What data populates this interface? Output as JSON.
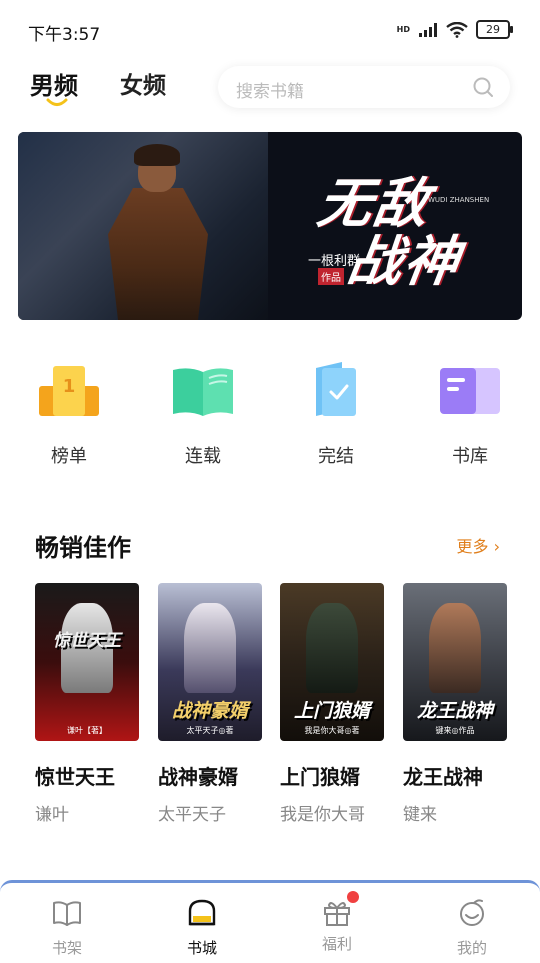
{
  "status": {
    "time": "下午3:57",
    "network": "HD",
    "battery": "29"
  },
  "top_nav": {
    "tabs": [
      "男频",
      "女频"
    ],
    "active": "男频",
    "search_placeholder": "搜索书籍"
  },
  "banner": {
    "title_line1": "无敌",
    "title_line2": "战神",
    "author": "一根利群",
    "badge": "作品",
    "pinyin": "WUDI ZHANSHEN"
  },
  "categories": [
    {
      "label": "榜单",
      "icon": "ranking-icon"
    },
    {
      "label": "连载",
      "icon": "open-book-icon"
    },
    {
      "label": "完结",
      "icon": "finished-book-icon"
    },
    {
      "label": "书库",
      "icon": "library-icon"
    }
  ],
  "section": {
    "title": "畅销佳作",
    "more": "更多 ›"
  },
  "books": [
    {
      "title": "惊世天王",
      "author": "谦叶",
      "cover_title": "惊世天王",
      "cover_author": "谦叶【著】"
    },
    {
      "title": "战神豪婿",
      "author": "太平天子",
      "cover_title": "战神豪婿",
      "cover_author": "太平天子◎著"
    },
    {
      "title": "上门狼婿",
      "author": "我是你大哥",
      "cover_title": "上门狼婿",
      "cover_author": "我是你大哥◎著"
    },
    {
      "title": "龙王战神",
      "author": "键来",
      "cover_title": "龙王战神",
      "cover_author": "键来◎作品"
    }
  ],
  "tabbar": [
    {
      "label": "书架",
      "icon": "bookshelf-icon"
    },
    {
      "label": "书城",
      "icon": "bookstore-icon",
      "active": true
    },
    {
      "label": "福利",
      "icon": "gift-icon",
      "badge": true
    },
    {
      "label": "我的",
      "icon": "profile-icon"
    }
  ],
  "colors": {
    "accent": "#f4c21a",
    "more_link": "#e07f1c",
    "badge_red": "#f04040"
  }
}
